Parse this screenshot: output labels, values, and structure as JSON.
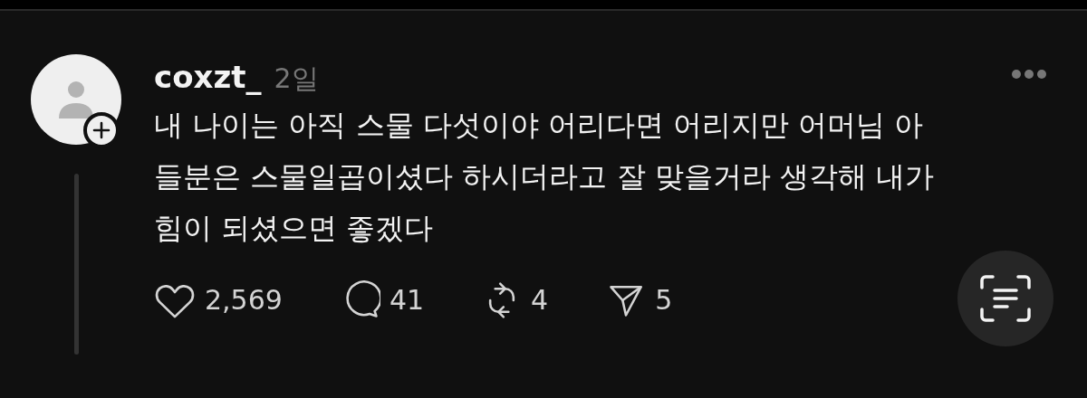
{
  "post": {
    "username": "coxzt_",
    "time": "2일",
    "body_lines": [
      "내 나이는 아직 스물 다섯이야 어리다면 어리지만 어머님 아",
      "들분은 스물일곱이셨다 하시더라고 잘 맞을거라 생각해 내가",
      "힘이 되셨으면 좋겠다"
    ],
    "actions": [
      {
        "kind": "like",
        "count": "2,569"
      },
      {
        "kind": "reply",
        "count": "41"
      },
      {
        "kind": "repost",
        "count": "4"
      },
      {
        "kind": "share",
        "count": "5"
      }
    ]
  }
}
